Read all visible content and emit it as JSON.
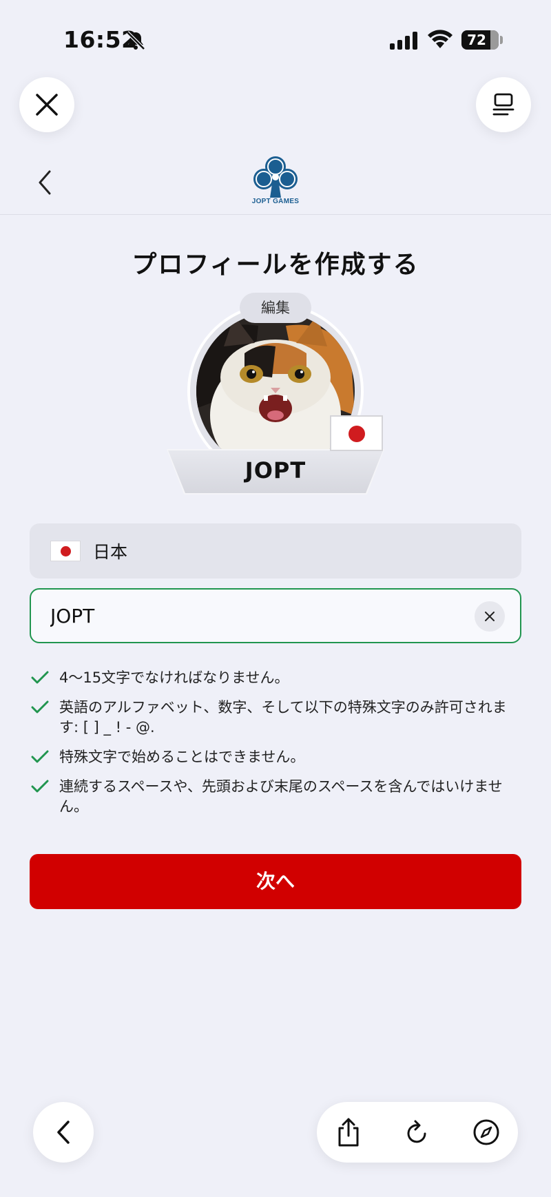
{
  "status_bar": {
    "time": "16:52",
    "battery": "72",
    "icons": [
      "bell-off-icon",
      "signal-icon",
      "wifi-icon",
      "battery-icon"
    ]
  },
  "app": {
    "logo_text": "JOPT GAMES",
    "brand_color": "#1b5e91"
  },
  "page": {
    "title": "プロフィールを作成する"
  },
  "profile": {
    "edit_label": "編集",
    "player_name": "JOPT",
    "country_flag": "flag-japan-icon"
  },
  "form": {
    "country": "日本",
    "name_value": "JOPT",
    "valid_color": "#21954f"
  },
  "rules": [
    "4〜15文字でなければなりません。",
    "英語のアルファベット、数字、そして以下の特殊文字のみ許可されます: [ ] _ ! - @.",
    "特殊文字で始めることはできません。",
    "連続するスペースや、先頭および末尾のスペースを含んではいけません。"
  ],
  "actions": {
    "next_label": "次へ",
    "next_color": "#d10000"
  },
  "browser_bar": {
    "icons": [
      "back-chevron-icon",
      "share-icon",
      "reload-icon",
      "compass-icon"
    ]
  }
}
